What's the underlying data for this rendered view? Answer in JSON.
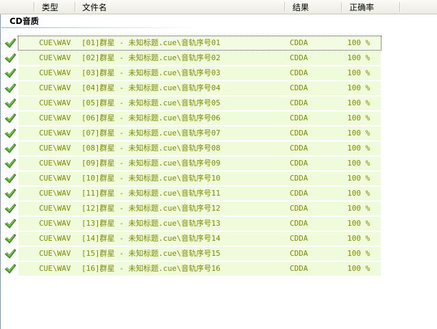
{
  "columns": {
    "type": "类型",
    "filename": "文件名",
    "result": "结果",
    "accuracy": "正确率"
  },
  "group": {
    "title": "CD音质"
  },
  "rows": [
    {
      "type": "CUE\\WAV",
      "filename": "[01]群星 - 未知标题.cue\\音轨序号01",
      "result": "CDDA",
      "accuracy": "100 %"
    },
    {
      "type": "CUE\\WAV",
      "filename": "[02]群星 - 未知标题.cue\\音轨序号02",
      "result": "CDDA",
      "accuracy": "100 %"
    },
    {
      "type": "CUE\\WAV",
      "filename": "[03]群星 - 未知标题.cue\\音轨序号03",
      "result": "CDDA",
      "accuracy": "100 %"
    },
    {
      "type": "CUE\\WAV",
      "filename": "[04]群星 - 未知标题.cue\\音轨序号04",
      "result": "CDDA",
      "accuracy": "100 %"
    },
    {
      "type": "CUE\\WAV",
      "filename": "[05]群星 - 未知标题.cue\\音轨序号05",
      "result": "CDDA",
      "accuracy": "100 %"
    },
    {
      "type": "CUE\\WAV",
      "filename": "[06]群星 - 未知标题.cue\\音轨序号06",
      "result": "CDDA",
      "accuracy": "100 %"
    },
    {
      "type": "CUE\\WAV",
      "filename": "[07]群星 - 未知标题.cue\\音轨序号07",
      "result": "CDDA",
      "accuracy": "100 %"
    },
    {
      "type": "CUE\\WAV",
      "filename": "[08]群星 - 未知标题.cue\\音轨序号08",
      "result": "CDDA",
      "accuracy": "100 %"
    },
    {
      "type": "CUE\\WAV",
      "filename": "[09]群星 - 未知标题.cue\\音轨序号09",
      "result": "CDDA",
      "accuracy": "100 %"
    },
    {
      "type": "CUE\\WAV",
      "filename": "[10]群星 - 未知标题.cue\\音轨序号10",
      "result": "CDDA",
      "accuracy": "100 %"
    },
    {
      "type": "CUE\\WAV",
      "filename": "[11]群星 - 未知标题.cue\\音轨序号11",
      "result": "CDDA",
      "accuracy": "100 %"
    },
    {
      "type": "CUE\\WAV",
      "filename": "[12]群星 - 未知标题.cue\\音轨序号12",
      "result": "CDDA",
      "accuracy": "100 %"
    },
    {
      "type": "CUE\\WAV",
      "filename": "[13]群星 - 未知标题.cue\\音轨序号13",
      "result": "CDDA",
      "accuracy": "100 %"
    },
    {
      "type": "CUE\\WAV",
      "filename": "[14]群星 - 未知标题.cue\\音轨序号14",
      "result": "CDDA",
      "accuracy": "100 %"
    },
    {
      "type": "CUE\\WAV",
      "filename": "[15]群星 - 未知标题.cue\\音轨序号15",
      "result": "CDDA",
      "accuracy": "100 %"
    },
    {
      "type": "CUE\\WAV",
      "filename": "[16]群星 - 未知标题.cue\\音轨序号16",
      "result": "CDDA",
      "accuracy": "100 %"
    }
  ],
  "colors": {
    "row_text": "#7c8a00",
    "row_bg": "#f0fbdc",
    "check": "#3f9a1a"
  },
  "icons": {
    "row_status": "checkmark-icon"
  }
}
